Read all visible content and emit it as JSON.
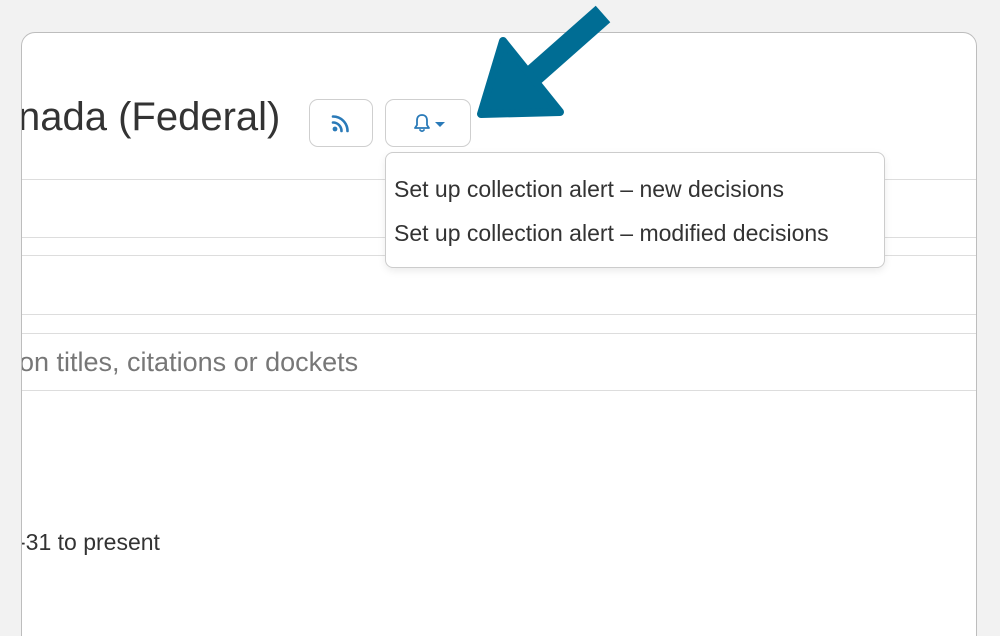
{
  "header": {
    "title": "nada (Federal)"
  },
  "toolbar": {
    "rss_icon": "rss-icon",
    "alert_icon": "bell-icon"
  },
  "alert_menu": {
    "items": [
      {
        "label": "Set up collection alert – new decisions"
      },
      {
        "label": "Set up collection alert – modified decisions"
      }
    ]
  },
  "search": {
    "placeholder": "on titles, citations or dockets"
  },
  "coverage": {
    "text": "-31 to present"
  },
  "colors": {
    "accent": "#2a7ab8",
    "annotation_arrow": "#006d94",
    "background": "#f2f2f2",
    "card_border": "#bdbdbd"
  }
}
